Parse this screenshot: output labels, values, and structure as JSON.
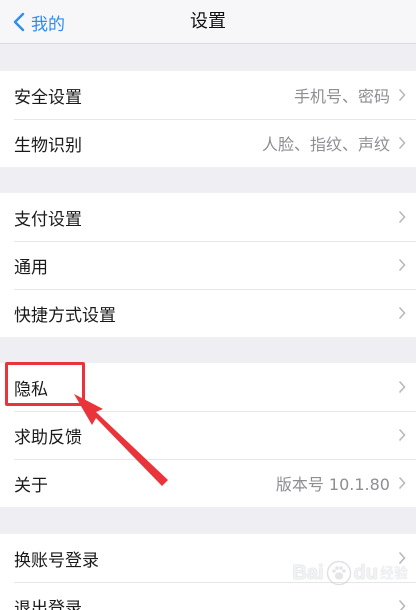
{
  "nav": {
    "back_label": "我的",
    "title": "设置"
  },
  "groups": [
    {
      "rows": [
        {
          "label": "安全设置",
          "detail": "手机号、密码"
        },
        {
          "label": "生物识别",
          "detail": "人脸、指纹、声纹"
        }
      ]
    },
    {
      "rows": [
        {
          "label": "支付设置",
          "detail": ""
        },
        {
          "label": "通用",
          "detail": ""
        },
        {
          "label": "快捷方式设置",
          "detail": ""
        }
      ]
    },
    {
      "rows": [
        {
          "label": "隐私",
          "detail": ""
        },
        {
          "label": "求助反馈",
          "detail": ""
        },
        {
          "label": "关于",
          "detail": "版本号 10.1.80"
        }
      ]
    },
    {
      "rows": [
        {
          "label": "换账号登录",
          "detail": ""
        },
        {
          "label": "退出登录",
          "detail": ""
        }
      ]
    }
  ],
  "watermark": {
    "text_left": "Bai",
    "text_right": "du",
    "sub": "经验"
  },
  "colors": {
    "accent": "#2f8cf0",
    "annotation": "#e8343a",
    "background": "#eeeef3"
  }
}
